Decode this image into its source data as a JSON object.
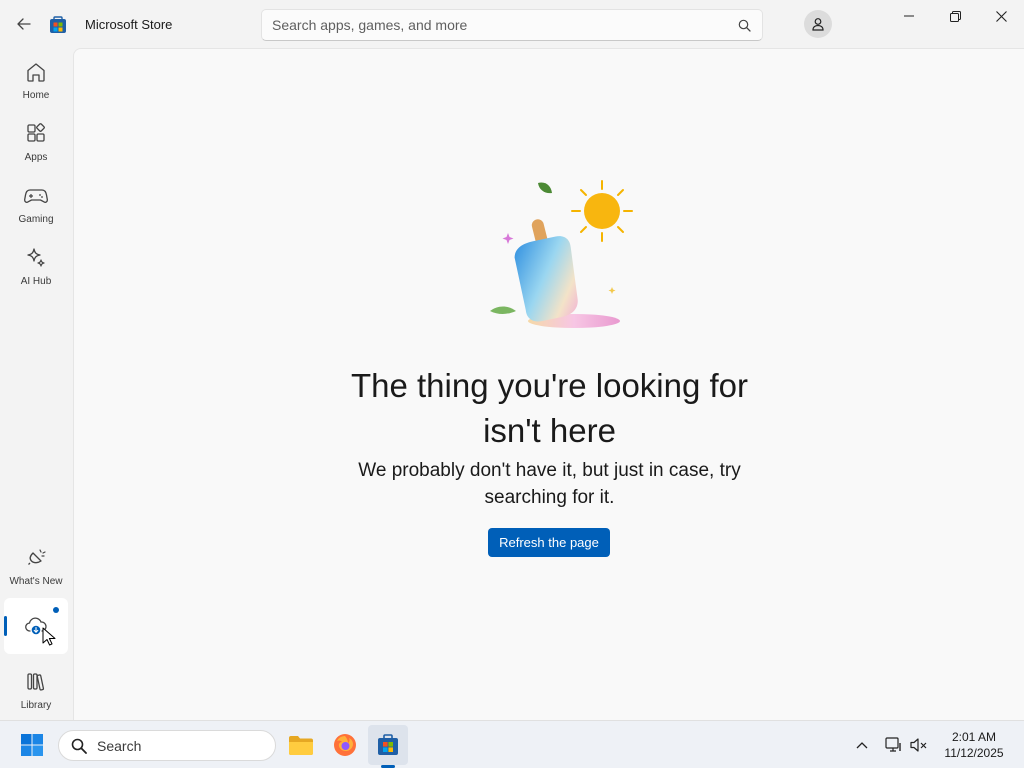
{
  "titlebar": {
    "app_title": "Microsoft Store",
    "search_placeholder": "Search apps, games, and more",
    "search_value": ""
  },
  "sidebar": {
    "items": [
      {
        "label": "Home",
        "icon": "home-icon"
      },
      {
        "label": "Apps",
        "icon": "apps-icon"
      },
      {
        "label": "Gaming",
        "icon": "gamepad-icon"
      },
      {
        "label": "AI Hub",
        "icon": "sparkle-icon"
      }
    ],
    "bottom_items": [
      {
        "label": "What's New",
        "icon": "megaphone-icon"
      },
      {
        "label": "",
        "icon": "cloud-download-icon",
        "active": true,
        "badge": "dot"
      },
      {
        "label": "Library",
        "icon": "library-icon"
      }
    ]
  },
  "main": {
    "headline": "The thing you're looking for isn't here",
    "subline": "We probably don't have it, but just in case, try searching for it.",
    "refresh_label": "Refresh the page"
  },
  "taskbar": {
    "search_label": "Search",
    "pinned": [
      "start-icon",
      "file-explorer-icon",
      "firefox-icon",
      "microsoft-store-icon"
    ],
    "time": "2:01 AM",
    "date": "11/12/2025"
  },
  "colors": {
    "accent": "#005fb8",
    "window_bg": "#f3f3f3",
    "content_bg": "#f9f9f9",
    "taskbar_bg": "#eef1f6"
  }
}
